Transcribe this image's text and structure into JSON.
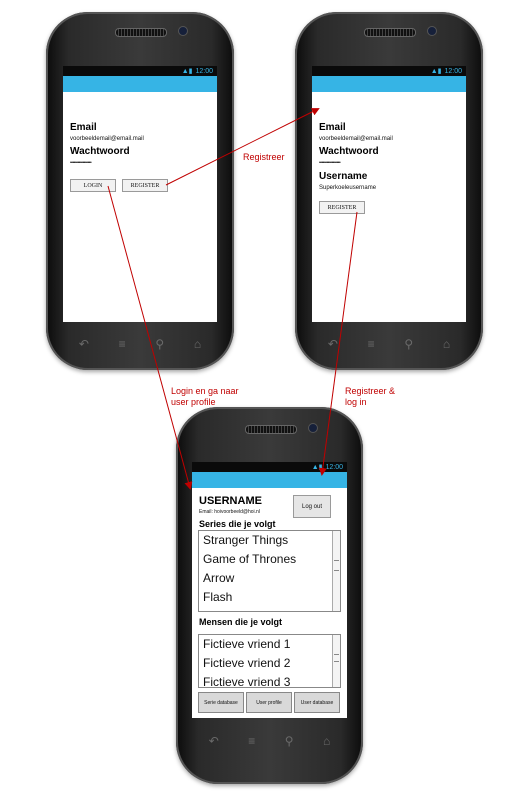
{
  "status_time": "12:00",
  "accent_color": "#36b4e5",
  "arrow_color": "#c00000",
  "login_screen": {
    "email_label": "Email",
    "email_value": "voorbeeldemail@email.mail",
    "password_label": "Wachtwoord",
    "password_value": "•••••••••••••••••",
    "login_button": "LOGIN",
    "register_button": "REGISTER"
  },
  "register_screen": {
    "email_label": "Email",
    "email_value": "voorbeeldemail@email.mail",
    "password_label": "Wachtwoord",
    "password_value": "•••••••••••••••••",
    "username_label": "Username",
    "username_value": "Superkoeleusername",
    "register_button": "REGISTER"
  },
  "profile_screen": {
    "username": "USERNAME",
    "email_line": "Email: hoivoorbeeld@hoi.nl",
    "logout_button": "Log out",
    "series_heading": "Series die je volgt",
    "series": [
      "Stranger Things",
      "Game of Thrones",
      "Arrow",
      "Flash"
    ],
    "people_heading": "Mensen die je volgt",
    "people": [
      "Fictieve vriend 1",
      "Fictieve vriend 2",
      "Fictieve vriend 3"
    ],
    "bottom_buttons": [
      "Serie database",
      "User profile",
      "User database"
    ]
  },
  "annotations": {
    "registreer": "Registreer",
    "login_line1": "Login en ga naar",
    "login_line2": "user profile",
    "registreer_login_line1": "Registreer &",
    "registreer_login_line2": "log in"
  }
}
